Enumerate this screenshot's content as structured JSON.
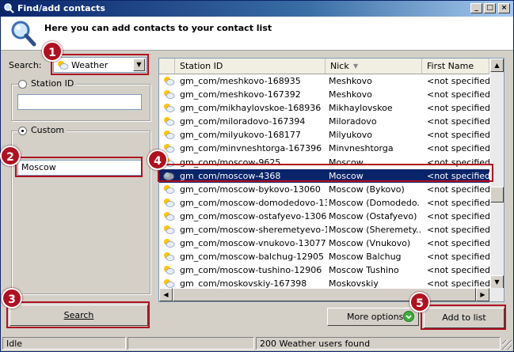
{
  "window": {
    "title": "Find/add contacts",
    "controls": [
      "_",
      "□",
      "×"
    ]
  },
  "header": {
    "text": "Here you can add contacts to your contact list",
    "icon": "magnifier-icon"
  },
  "search": {
    "label": "Search:",
    "protocol": "Weather"
  },
  "station_group": {
    "label": "Station ID",
    "value": ""
  },
  "custom_group": {
    "label": "Custom",
    "value": "Moscow"
  },
  "buttons": {
    "search": "Search",
    "more_options": "More options",
    "add_to_list": "Add to list"
  },
  "list": {
    "columns": [
      "Station ID",
      "Nick",
      "First Name"
    ],
    "rows": [
      {
        "id": "gm_com/meshkovo-168935",
        "nick": "Meshkovo",
        "first": "<not specified>"
      },
      {
        "id": "gm_com/meshkovo-167392",
        "nick": "Meshkovo",
        "first": "<not specified>"
      },
      {
        "id": "gm_com/mikhaylovskoe-168936",
        "nick": "Mikhaylovskoe",
        "first": "<not specified>"
      },
      {
        "id": "gm_com/miloradovo-167394",
        "nick": "Miloradovo",
        "first": "<not specified>"
      },
      {
        "id": "gm_com/milyukovo-168177",
        "nick": "Milyukovo",
        "first": "<not specified>"
      },
      {
        "id": "gm_com/minvneshtorga-167396",
        "nick": "Minvneshtorga",
        "first": "<not specified>"
      },
      {
        "id": "gm_com/moscow-9625",
        "nick": "Moscow",
        "first": "<not specified>"
      },
      {
        "id": "gm_com/moscow-4368",
        "nick": "Moscow",
        "first": "<not specified>"
      },
      {
        "id": "gm_com/moscow-bykovo-13060",
        "nick": "Moscow (Bykovo)",
        "first": "<not specified>"
      },
      {
        "id": "gm_com/moscow-domodedovo-13...",
        "nick": "Moscow (Domodedo...",
        "first": "<not specified>"
      },
      {
        "id": "gm_com/moscow-ostafyevo-13069",
        "nick": "Moscow (Ostafyevo)",
        "first": "<not specified>"
      },
      {
        "id": "gm_com/moscow-sheremetyevo-1...",
        "nick": "Moscow (Sheremety...",
        "first": "<not specified>"
      },
      {
        "id": "gm_com/moscow-vnukovo-13077",
        "nick": "Moscow (Vnukovo)",
        "first": "<not specified>"
      },
      {
        "id": "gm_com/moscow-balchug-12905",
        "nick": "Moscow Balchug",
        "first": "<not specified>"
      },
      {
        "id": "gm_com/moscow-tushino-12906",
        "nick": "Moscow Tushino",
        "first": "<not specified>"
      },
      {
        "id": "gm_com/moskovskiy-167398",
        "nick": "Moskovskiy",
        "first": "<not specified>"
      }
    ],
    "selected_index": 7
  },
  "status": {
    "state": "Idle",
    "middle": "",
    "found": "200 Weather users found"
  },
  "callouts": [
    "1",
    "2",
    "3",
    "4",
    "5"
  ],
  "colors": {
    "callout": "#b01020",
    "selection": "#0a246a",
    "title_bar": "#0a246a"
  }
}
